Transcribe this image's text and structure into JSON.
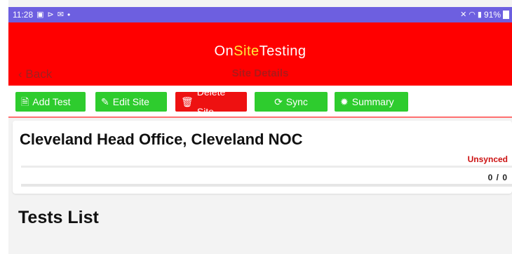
{
  "status_bar": {
    "time": "11:28",
    "left_icons": [
      "gallery-icon",
      "cast-icon",
      "mail-icon"
    ],
    "dot": "•",
    "battery": "91%"
  },
  "header": {
    "brand_on": "On",
    "brand_site": "Site",
    "brand_testing": "Testing",
    "back_label": "Back",
    "back_arrow": "‹",
    "title": "Site Details"
  },
  "toolbar": {
    "add_test": "Add Test",
    "edit_site": "Edit Site",
    "delete_site": "Delete Site",
    "sync": "Sync",
    "summary": "Summary"
  },
  "site_card": {
    "name": "Cleveland Head Office, Cleveland NOC",
    "status": "Unsynced",
    "count": "0 / 0"
  },
  "tests": {
    "heading": "Tests List"
  },
  "colors": {
    "header_red": "#ff0000",
    "button_green": "#2ecc2e",
    "button_red": "#ee1111",
    "status_bar": "#6d5fe0"
  }
}
